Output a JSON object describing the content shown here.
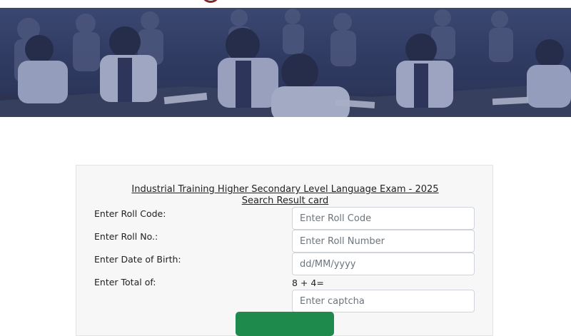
{
  "banner": {
    "alt_icon": "classroom-students-image"
  },
  "form": {
    "title_line1": "Industrial Training Higher Secondary Level Language Exam - 2025",
    "title_line2": "Search Result card",
    "roll_code": {
      "label": "Enter Roll Code:",
      "placeholder": "Enter Roll Code",
      "value": ""
    },
    "roll_no": {
      "label": "Enter Roll No.:",
      "placeholder": "Enter Roll Number",
      "value": ""
    },
    "dob": {
      "label": "Enter Date of Birth:",
      "placeholder": "dd/MM/yyyy",
      "value": ""
    },
    "captcha": {
      "label": "Enter Total of:",
      "question": "8 + 4=",
      "placeholder": "Enter captcha",
      "value": ""
    },
    "submit_label": ""
  },
  "colors": {
    "submit": "#1e8a4c",
    "banner_tint": "#34406e",
    "card_bg": "#f7f7f7"
  }
}
